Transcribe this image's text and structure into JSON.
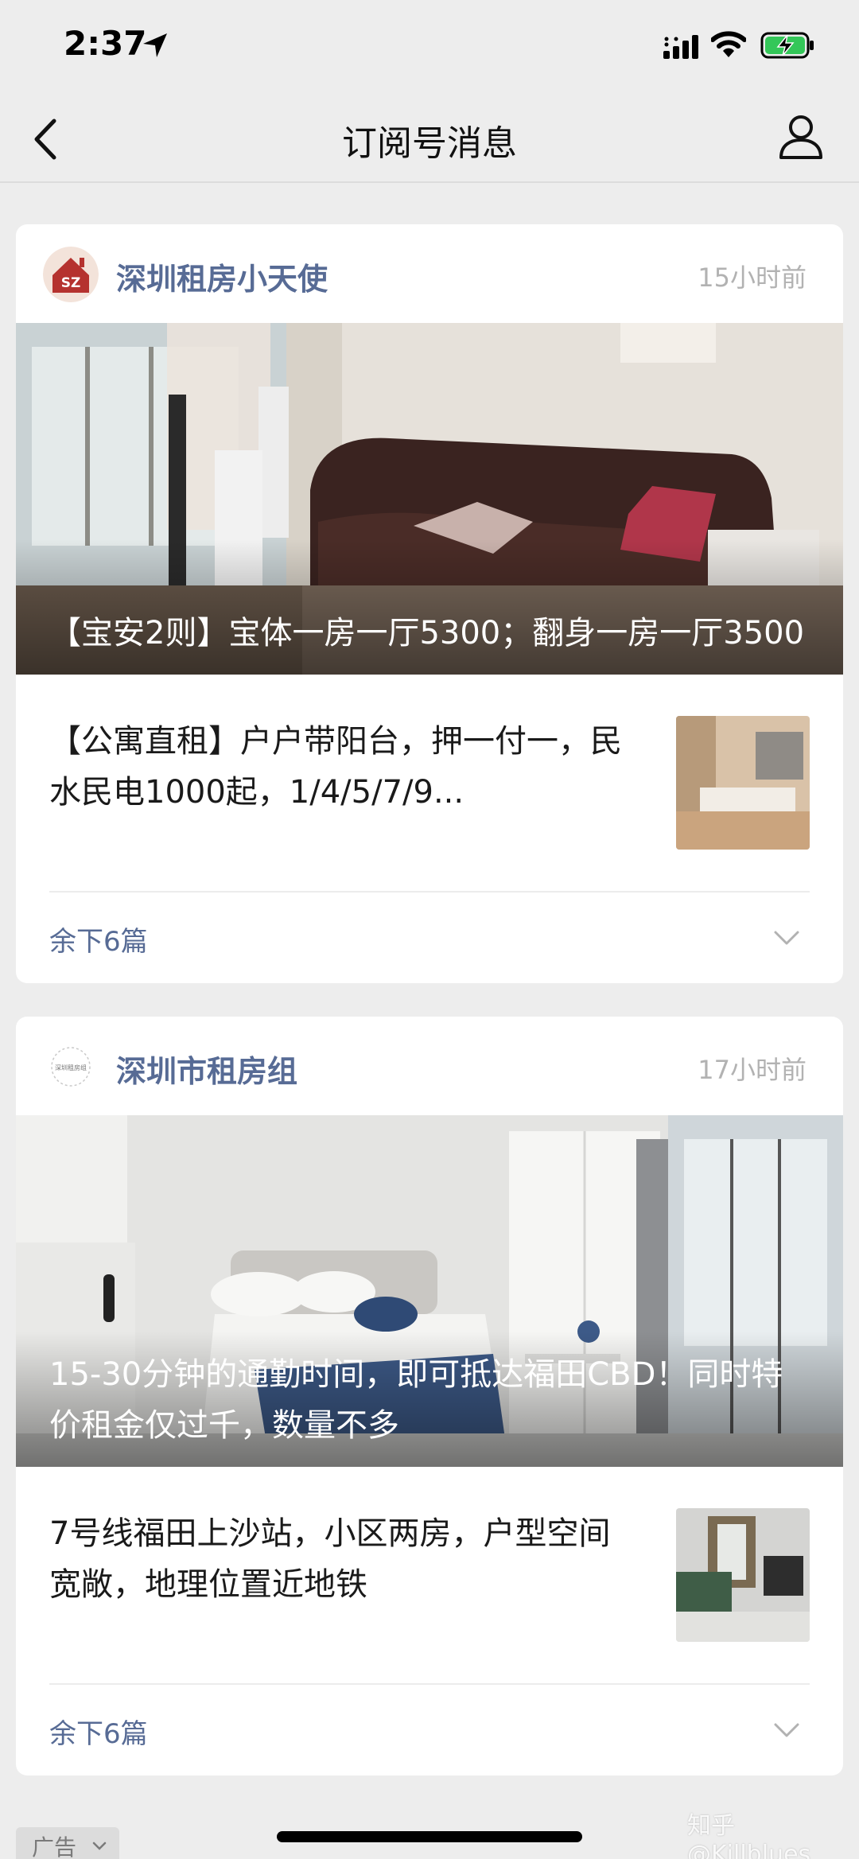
{
  "status_bar": {
    "time": "2:37"
  },
  "nav": {
    "title": "订阅号消息"
  },
  "cards": [
    {
      "account_name": "深圳租房小天使",
      "avatar_text": "SZ",
      "time": "15小时前",
      "cover_title": "【宝安2则】宝体一房一厅5300；翻身一房一厅3500",
      "sub_title": "【公寓直租】户户带阳台，押一付一，民水民电1000起，1/4/5/7/9...",
      "more_label": "余下6篇"
    },
    {
      "account_name": "深圳市租房组",
      "avatar_text": "深圳租房组",
      "time": "17小时前",
      "cover_title": "15-30分钟的通勤时间，即可抵达福田CBD！同时特价租金仅过千，数量不多",
      "sub_title": "7号线福田上沙站，小区两房，户型空间宽敞，地理位置近地铁",
      "more_label": "余下6篇"
    }
  ],
  "ad": {
    "label": "广告"
  },
  "watermark": "知乎 @Killblues",
  "colors": {
    "link_blue": "#576b95",
    "background": "#ededed",
    "battery_green": "#34c759"
  }
}
